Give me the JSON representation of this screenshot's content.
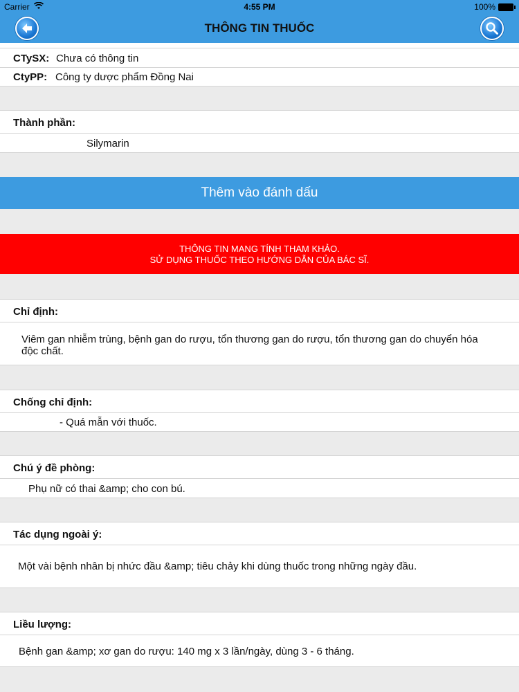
{
  "status_bar": {
    "carrier": "Carrier",
    "time": "4:55 PM",
    "battery": "100%"
  },
  "nav": {
    "title": "THÔNG TIN THUỐC",
    "back_icon": "back-arrow-icon",
    "search_icon": "search-icon"
  },
  "info": {
    "ctysx_label": "CTySX:",
    "ctysx_value": "Chưa có thông tin",
    "ctypp_label": "CtyPP:",
    "ctypp_value": "Công ty dược phẩm Đồng Nai"
  },
  "ingredients": {
    "label": "Thành phần:",
    "value": "Silymarin"
  },
  "bookmark_button": "Thêm vào đánh dấu",
  "warning": {
    "line1": "THÔNG TIN MANG TÍNH THAM KHẢO.",
    "line2": "SỬ DỤNG THUỐC THEO HƯỚNG DẪN CỦA BÁC SĨ."
  },
  "sections": {
    "indication": {
      "label": "Chỉ định:",
      "line1": "Viêm gan nhiễm trùng, bệnh gan do rượu, tổn thương gan do rượu, tổn thương gan do chuyển hóa",
      "line2": "độc chất."
    },
    "contraindication": {
      "label": "Chống chỉ định:",
      "text": "- Quá mẫn với thuốc."
    },
    "precaution": {
      "label": "Chú ý đề phòng:",
      "text": "Phụ nữ có thai &amp; cho con bú."
    },
    "side_effects": {
      "label": "Tác dụng ngoài ý:",
      "text": "Một vài bệnh nhân bị nhức đầu &amp; tiêu chảy khi dùng thuốc trong những ngày đầu."
    },
    "dosage": {
      "label": "Liều lượng:",
      "text": "Bệnh gan &amp; xơ gan do rượu: 140 mg x 3 lần/ngày, dùng 3 - 6 tháng."
    }
  },
  "colors": {
    "nav_blue": "#3d9be0",
    "warning_red": "#ff0000",
    "background": "#ebebeb"
  }
}
